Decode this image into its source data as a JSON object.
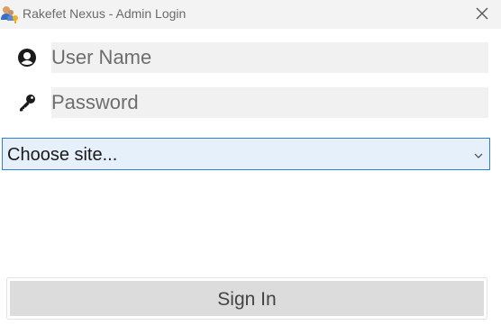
{
  "window": {
    "title": "Rakefet Nexus - Admin Login",
    "app_icon": "users-key-icon",
    "close_icon": "close-icon"
  },
  "form": {
    "username_placeholder": "User Name",
    "username_value": "",
    "username_icon": "user-circle-icon",
    "password_placeholder": "Password",
    "password_value": "",
    "password_icon": "key-icon",
    "site_select_value": "Choose site...",
    "site_select_icon": "chevron-down-icon",
    "signin_label": "Sign In"
  },
  "colors": {
    "titlebar_bg": "#f3f3f3",
    "input_bg": "#f1f1f1",
    "select_border": "#2f7ed8",
    "select_bg": "#e6f0fa",
    "button_bg": "#dcdcdc"
  }
}
